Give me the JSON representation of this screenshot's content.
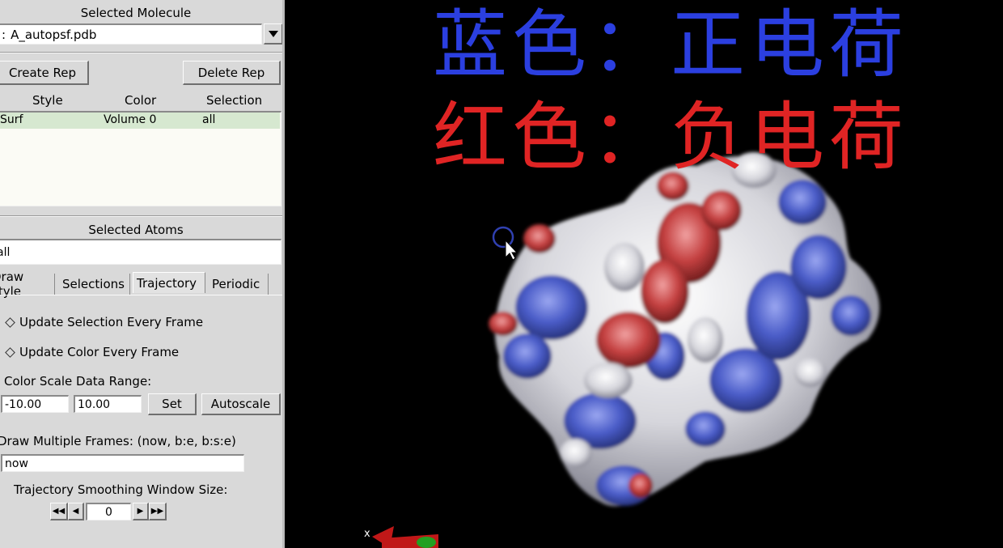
{
  "panel": {
    "selected_molecule_label": "Selected Molecule",
    "molecule_prefix": ":",
    "molecule_value": "A_autopsf.pdb",
    "create_rep": "Create Rep",
    "delete_rep": "Delete Rep",
    "rep_headers": [
      "Style",
      "Color",
      "Selection"
    ],
    "rep_rows": [
      {
        "style": "Surf",
        "color": "Volume 0",
        "selection": "all"
      }
    ],
    "selected_atoms_label": "Selected Atoms",
    "selected_atoms_value": "all",
    "tabs": [
      "Draw style",
      "Selections",
      "Trajectory",
      "Periodic"
    ],
    "active_tab": "Trajectory",
    "update_selection": "Update Selection Every Frame",
    "update_color": "Update Color Every Frame",
    "color_scale_label": "Color Scale Data Range:",
    "range_min": "-10.00",
    "range_max": "10.00",
    "set_button": "Set",
    "autoscale_button": "Autoscale",
    "draw_multiple_label": "Draw Multiple Frames: (now, b:e, b:s:e)",
    "draw_multiple_value": "now",
    "smoothing_label": "Trajectory Smoothing Window Size:",
    "smoothing_value": "0"
  },
  "viewport": {
    "line1": "蓝色：正电荷",
    "line2": "红色：负电荷",
    "line1_color": "#2b3fe0",
    "line2_color": "#e02424",
    "axis_x_label": "x"
  },
  "colors": {
    "panel_bg": "#d9d9d9",
    "viewport_bg": "#000000",
    "rep_row_bg": "#d6e8d0",
    "surface_blue": "#4a5cc8",
    "surface_red": "#c44040",
    "surface_white": "#e8e8e8"
  }
}
